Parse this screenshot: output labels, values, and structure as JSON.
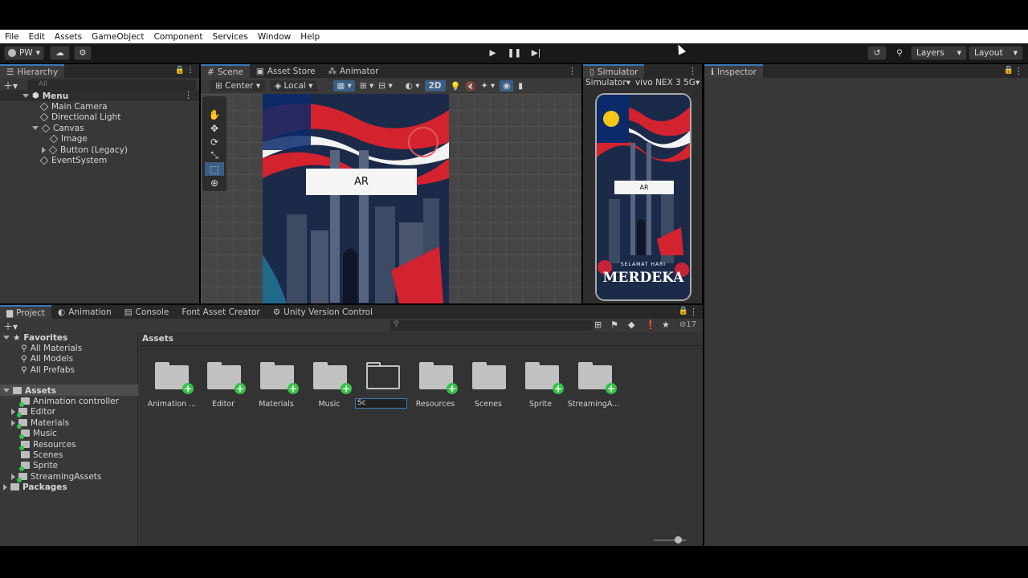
{
  "menu": [
    "File",
    "Edit",
    "Assets",
    "GameObject",
    "Component",
    "Services",
    "Window",
    "Help"
  ],
  "toolbar": {
    "account": "PW",
    "layers": "Layers",
    "layout": "Layout"
  },
  "hierarchy": {
    "tab": "Hierarchy",
    "search_placeholder": "All",
    "scene": "Menu",
    "items": [
      "Main Camera",
      "Directional Light",
      "Canvas",
      "Image",
      "Button (Legacy)",
      "EventSystem"
    ]
  },
  "scene_tabs": [
    "Scene",
    "Asset Store",
    "Animator"
  ],
  "scene_toolbar": {
    "pivot": "Center",
    "space": "Local",
    "mode2d": "2D"
  },
  "scene_button_text": "AR",
  "simulator": {
    "tab": "Simulator",
    "mode": "Simulator",
    "device": "vivo NEX 3 5G",
    "button_text": "AR",
    "banner_small": "SELAMAT HARI",
    "banner_big": "MERDEKA"
  },
  "inspector": {
    "tab": "Inspector"
  },
  "bottom_tabs": [
    "Project",
    "Animation",
    "Console",
    "Font Asset Creator",
    "Unity Version Control"
  ],
  "project": {
    "hidden_count": "17",
    "favorites_label": "Favorites",
    "favorites": [
      "All Materials",
      "All Models",
      "All Prefabs"
    ],
    "assets_label": "Assets",
    "tree": [
      "Animation controller",
      "Editor",
      "Materials",
      "Music",
      "Resources",
      "Scenes",
      "Sprite",
      "StreamingAssets"
    ],
    "packages": "Packages",
    "breadcrumb": "Assets",
    "folders": [
      "Animation ...",
      "Editor",
      "Materials",
      "Music",
      "Sc",
      "Resources",
      "Scenes",
      "Sprite",
      "StreamingA..."
    ]
  },
  "colors": {
    "accent": "#3a79bb",
    "flag_red": "#d3232f",
    "flag_blue": "#0b2a6b",
    "flag_yellow": "#f5c518",
    "plus_green": "#37c24a"
  }
}
